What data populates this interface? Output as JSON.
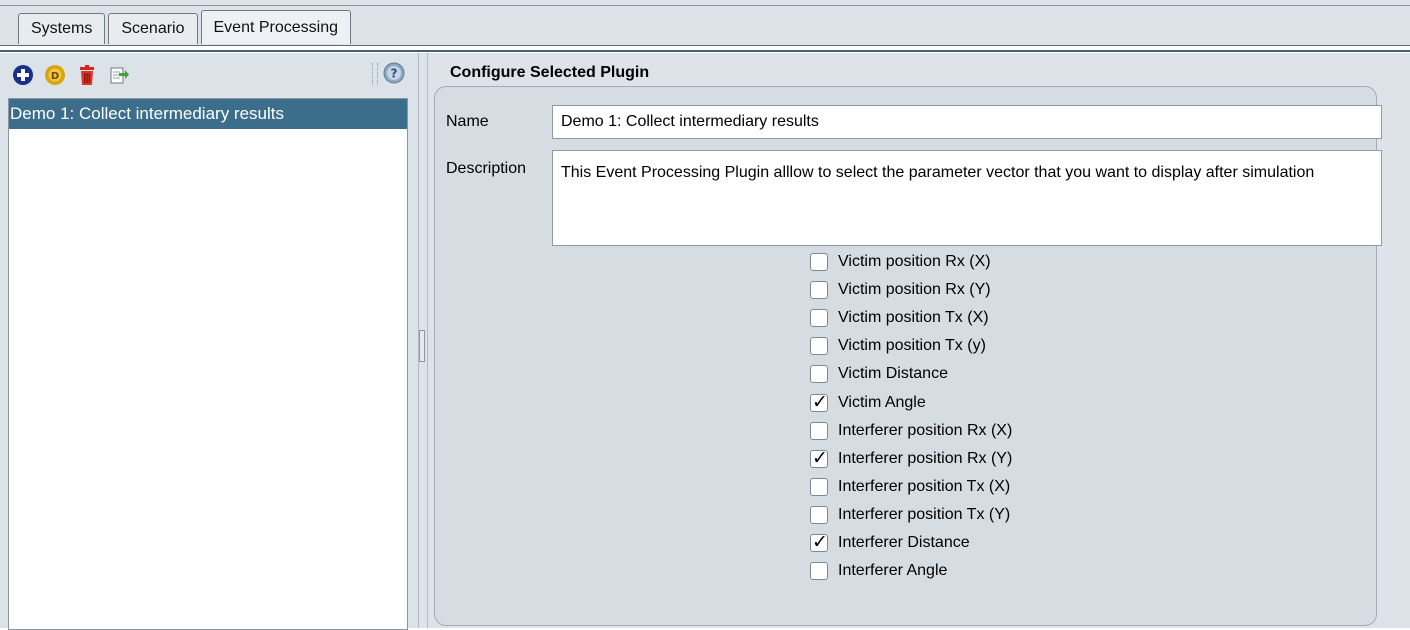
{
  "tabs": [
    "Systems",
    "Scenario",
    "Event Processing"
  ],
  "active_tab": "Event Processing",
  "toolbar": {
    "icons": [
      "add-icon",
      "duplicate-icon",
      "delete-icon",
      "export-icon"
    ],
    "help_icon": "help-icon"
  },
  "plugin_list": {
    "items": [
      "Demo 1: Collect intermediary results"
    ],
    "selected": "Demo 1: Collect intermediary results"
  },
  "config": {
    "title": "Configure Selected Plugin",
    "name_label": "Name",
    "name_value": "Demo 1: Collect intermediary results",
    "description_label": "Description",
    "description_value": "This Event Processing Plugin alllow to select the parameter vector that you want to display after simulation",
    "checkboxes": [
      {
        "label": "Victim position Rx (X)",
        "checked": false
      },
      {
        "label": "Victim position Rx (Y)",
        "checked": false
      },
      {
        "label": "Victim position Tx (X)",
        "checked": false
      },
      {
        "label": "Victim position Tx (y)",
        "checked": false
      },
      {
        "label": "Victim Distance",
        "checked": false
      },
      {
        "label": "Victim Angle",
        "checked": true
      },
      {
        "label": "Interferer position Rx (X)",
        "checked": false
      },
      {
        "label": "Interferer position Rx (Y)",
        "checked": true
      },
      {
        "label": "Interferer position Tx (X)",
        "checked": false
      },
      {
        "label": "Interferer position Tx (Y)",
        "checked": false
      },
      {
        "label": "Interferer Distance",
        "checked": true
      },
      {
        "label": "Interferer Angle",
        "checked": false
      }
    ]
  },
  "colors": {
    "selection": "#3c6e8c",
    "panel": "#dde3e8"
  }
}
